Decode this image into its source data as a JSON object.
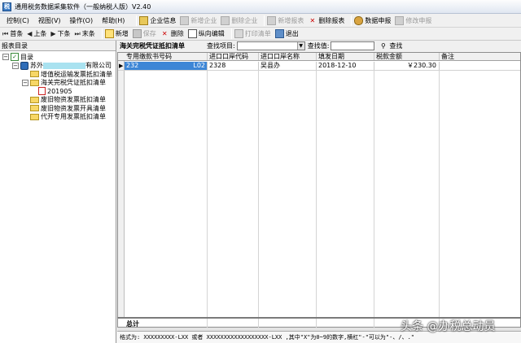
{
  "window": {
    "title": "通用税务数据采集软件（一般纳税人版）V2.40"
  },
  "menubar": {
    "menus": [
      "控制(C)",
      "视图(V)",
      "操作(O)",
      "帮助(H)"
    ],
    "tools": [
      {
        "label": "企业信息",
        "icon": "company-info-icon",
        "enabled": true
      },
      {
        "label": "新增企业",
        "icon": "add-company-icon",
        "enabled": false
      },
      {
        "label": "删除企业",
        "icon": "delete-company-icon",
        "enabled": false
      },
      {
        "label": "新增报表",
        "icon": "add-report-icon",
        "enabled": false
      },
      {
        "label": "删除报表",
        "icon": "delete-report-icon",
        "enabled": true
      },
      {
        "label": "数据申报",
        "icon": "data-declare-icon",
        "enabled": true
      },
      {
        "label": "修改申报",
        "icon": "modify-declare-icon",
        "enabled": false
      }
    ]
  },
  "toolbar": {
    "first": "首条",
    "prev": "上条",
    "next": "下条",
    "last": "末条",
    "add": "新增",
    "save": "保存",
    "delete": "删除",
    "vertical_edit": "纵向编辑",
    "print": "打印清单",
    "exit": "退出"
  },
  "tree": {
    "title": "报表目录",
    "root": "目录",
    "company_prefix": "苏外",
    "company_suffix": "有限公司",
    "items": [
      "增值税运输发票抵扣清单",
      "海关完税凭证抵扣清单",
      "201905",
      "废旧物资发票抵扣清单",
      "废旧物资发票开具清单",
      "代开专用发票抵扣清单"
    ]
  },
  "main": {
    "tab": "海关完税凭证抵扣清单",
    "search_item_label": "查找项目:",
    "search_value_label": "查找值:",
    "find_label": "查找"
  },
  "grid": {
    "columns": [
      "专用缴款书号码",
      "进口口岸代码",
      "进口口岸名称",
      "填发日期",
      "税款金额",
      "备注"
    ],
    "rows": [
      {
        "number_start": "232",
        "number_end": "L02",
        "port_code": "2328",
        "port_name": "吴县办",
        "date": "2018-12-10",
        "tax_amount": "￥230.30",
        "note": ""
      }
    ],
    "total_label": "总计"
  },
  "status": {
    "text": "格式为: XXXXXXXXX-LXX 或者 XXXXXXXXXXXXXXXXXX-LXX ,其中\"X\"为0~9的数字,横杠\"-\"可以为\"-、/、.\""
  },
  "watermark": {
    "text": "头条 @办税总动员"
  },
  "colors": {
    "selection": "#3d86d6",
    "redaction": "#a9e2f0"
  }
}
